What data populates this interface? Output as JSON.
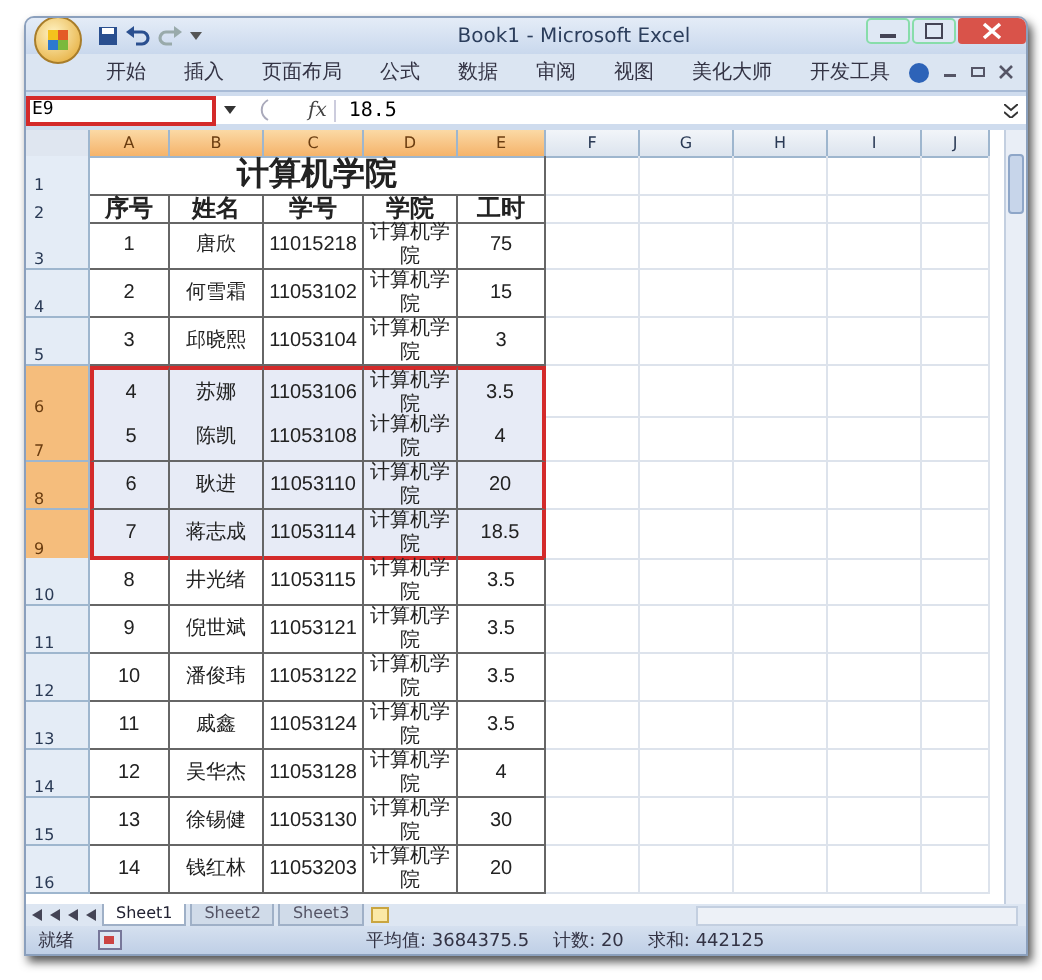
{
  "window": {
    "title": "Book1 - Microsoft Excel"
  },
  "ribbon_tabs": [
    {
      "label": "开始"
    },
    {
      "label": "插入"
    },
    {
      "label": "页面布局"
    },
    {
      "label": "公式"
    },
    {
      "label": "数据"
    },
    {
      "label": "审阅"
    },
    {
      "label": "视图"
    },
    {
      "label": "美化大师"
    },
    {
      "label": "开发工具"
    }
  ],
  "formula_bar": {
    "name_box": "E9",
    "fx": "fx",
    "value": "18.5"
  },
  "columns": [
    {
      "label": "A",
      "selected": true
    },
    {
      "label": "B",
      "selected": true
    },
    {
      "label": "C",
      "selected": true
    },
    {
      "label": "D",
      "selected": true
    },
    {
      "label": "E",
      "selected": true
    },
    {
      "label": "F",
      "selected": false
    },
    {
      "label": "G",
      "selected": false
    },
    {
      "label": "H",
      "selected": false
    },
    {
      "label": "I",
      "selected": false
    },
    {
      "label": "J",
      "selected": false
    }
  ],
  "rows": [
    {
      "number": "1",
      "kind": "title",
      "selected": false,
      "cells": [
        "计算机学院"
      ]
    },
    {
      "number": "2",
      "kind": "header",
      "selected": false,
      "cells": [
        "序号",
        "姓名",
        "学号",
        "学院",
        "工时"
      ]
    },
    {
      "number": "3",
      "kind": "data",
      "selected": false,
      "cells": [
        "1",
        "唐欣",
        "11015218",
        "计算机学院",
        "75"
      ]
    },
    {
      "number": "4",
      "kind": "data",
      "selected": false,
      "cells": [
        "2",
        "何雪霜",
        "11053102",
        "计算机学院",
        "15"
      ]
    },
    {
      "number": "5",
      "kind": "data",
      "selected": false,
      "cells": [
        "3",
        "邱晓熙",
        "11053104",
        "计算机学院",
        "3"
      ]
    },
    {
      "number": "6",
      "kind": "data",
      "selected": true,
      "cells": [
        "4",
        "苏娜",
        "11053106",
        "计算机学院",
        "3.5"
      ]
    },
    {
      "number": "7",
      "kind": "data",
      "selected": true,
      "cells": [
        "5",
        "陈凯",
        "11053108",
        "计算机学院",
        "4"
      ]
    },
    {
      "number": "8",
      "kind": "data",
      "selected": true,
      "cells": [
        "6",
        "耿进",
        "11053110",
        "计算机学院",
        "20"
      ]
    },
    {
      "number": "9",
      "kind": "data",
      "selected": true,
      "cells": [
        "7",
        "蒋志成",
        "11053114",
        "计算机学院",
        "18.5"
      ]
    },
    {
      "number": "10",
      "kind": "data",
      "selected": false,
      "cells": [
        "8",
        "井光绪",
        "11053115",
        "计算机学院",
        "3.5"
      ]
    },
    {
      "number": "11",
      "kind": "data",
      "selected": false,
      "cells": [
        "9",
        "倪世斌",
        "11053121",
        "计算机学院",
        "3.5"
      ]
    },
    {
      "number": "12",
      "kind": "data",
      "selected": false,
      "cells": [
        "10",
        "潘俊玮",
        "11053122",
        "计算机学院",
        "3.5"
      ]
    },
    {
      "number": "13",
      "kind": "data",
      "selected": false,
      "cells": [
        "11",
        "戚鑫",
        "11053124",
        "计算机学院",
        "3.5"
      ]
    },
    {
      "number": "14",
      "kind": "data",
      "selected": false,
      "cells": [
        "12",
        "吴华杰",
        "11053128",
        "计算机学院",
        "4"
      ]
    },
    {
      "number": "15",
      "kind": "data",
      "selected": false,
      "cells": [
        "13",
        "徐锡健",
        "11053130",
        "计算机学院",
        "30"
      ]
    },
    {
      "number": "16",
      "kind": "data",
      "selected": false,
      "cells": [
        "14",
        "钱红林",
        "11053203",
        "计算机学院",
        "20"
      ]
    }
  ],
  "sheet_tabs": [
    {
      "label": "Sheet1",
      "selected": true
    },
    {
      "label": "Sheet2",
      "selected": false
    },
    {
      "label": "Sheet3",
      "selected": false
    }
  ],
  "status_bar": {
    "mode": "就绪",
    "average": "平均值: 3684375.5",
    "count": "计数: 20",
    "sum": "求和: 442125"
  }
}
